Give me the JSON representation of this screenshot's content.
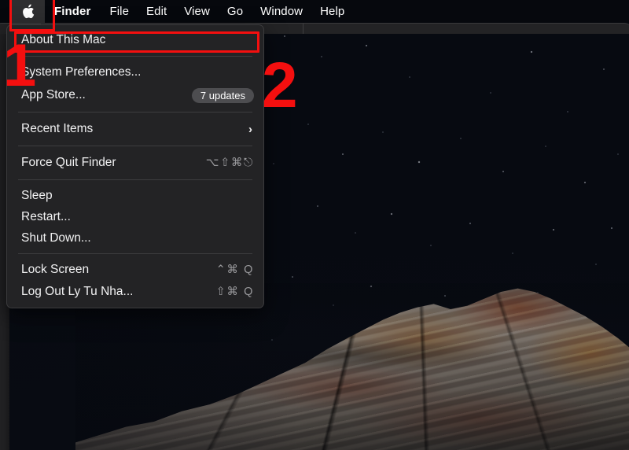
{
  "menubar": {
    "apple_icon": "apple-logo-icon",
    "items": [
      {
        "label": "Finder",
        "bold": true
      },
      {
        "label": "File",
        "bold": false
      },
      {
        "label": "Edit",
        "bold": false
      },
      {
        "label": "View",
        "bold": false
      },
      {
        "label": "Go",
        "bold": false
      },
      {
        "label": "Window",
        "bold": false
      },
      {
        "label": "Help",
        "bold": false
      }
    ]
  },
  "apple_menu": {
    "rows": [
      {
        "label": "About This Mac",
        "shortcut": "",
        "badge": "",
        "chevron": ""
      },
      {
        "label": "System Preferences...",
        "shortcut": "",
        "badge": "",
        "chevron": ""
      },
      {
        "label": "App Store...",
        "shortcut": "",
        "badge": "7 updates",
        "chevron": ""
      },
      {
        "label": "Recent Items",
        "shortcut": "",
        "badge": "",
        "chevron": "›"
      },
      {
        "label": "Force Quit Finder",
        "shortcut": "⌥⇧⌘⎋",
        "badge": "",
        "chevron": ""
      },
      {
        "label": "Sleep",
        "shortcut": "",
        "badge": "",
        "chevron": ""
      },
      {
        "label": "Restart...",
        "shortcut": "",
        "badge": "",
        "chevron": ""
      },
      {
        "label": "Shut Down...",
        "shortcut": "",
        "badge": "",
        "chevron": ""
      },
      {
        "label": "Lock Screen",
        "shortcut": "⌃⌘ Q",
        "badge": "",
        "chevron": ""
      },
      {
        "label": "Log Out Ly Tu Nha...",
        "shortcut": "⇧⌘ Q",
        "badge": "",
        "chevron": ""
      }
    ]
  },
  "annotations": {
    "step_one": "1",
    "step_two": "2",
    "highlight_color": "#f40f0f"
  },
  "desktop": {
    "wallpaper_name": "night-rock-formation-wallpaper"
  }
}
